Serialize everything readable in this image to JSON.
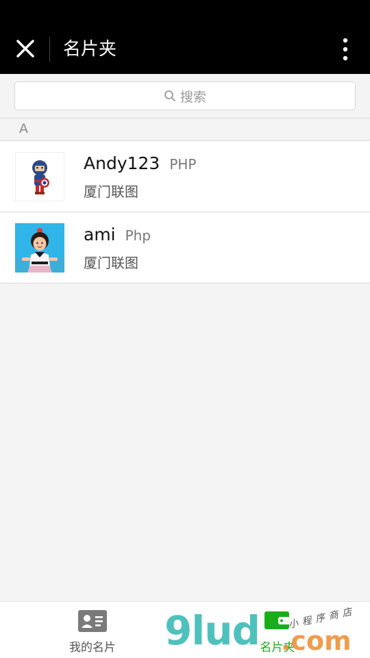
{
  "header": {
    "title": "名片夹",
    "close_icon": "close-icon",
    "more_icon": "more-vertical-icon"
  },
  "search": {
    "placeholder": "搜索",
    "icon": "search-icon"
  },
  "section": {
    "letter": "A"
  },
  "contacts": [
    {
      "name": "Andy123",
      "title": "PHP",
      "company": "厦门联图",
      "avatar": "captain-america-figure-avatar"
    },
    {
      "name": "ami",
      "title": "Php",
      "company": "厦门联图",
      "avatar": "child-photo-avatar"
    }
  ],
  "tabbar": {
    "tabs": [
      {
        "label": "我的名片",
        "icon": "contact-card-icon",
        "active": false
      },
      {
        "label": "名片夹",
        "icon": "card-holder-icon",
        "active": true
      }
    ]
  },
  "watermark": {
    "brand": "9lud",
    "domain": ".com",
    "cn_text": "小程序商店"
  },
  "colors": {
    "header_bg": "#000000",
    "accent_green": "#1aad19",
    "background": "#f4f4f4",
    "watermark_teal": "#3dbbb6",
    "watermark_orange": "#f0913a"
  }
}
